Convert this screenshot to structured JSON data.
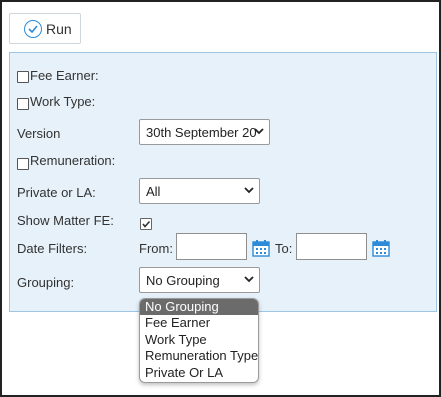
{
  "toolbar": {
    "run_label": "Run"
  },
  "form": {
    "fee_earner_label": "Fee Earner:",
    "work_type_label": "Work Type:",
    "version_label": "Version",
    "version_value": "30th September 20",
    "remuneration_label": "Remuneration:",
    "private_la_label": "Private or LA:",
    "private_la_value": "All",
    "show_matter_fe_label": "Show Matter FE:",
    "show_matter_fe_checked": true,
    "date_filters_label": "Date Filters:",
    "from_label": "From:",
    "to_label": "To:",
    "from_value": "",
    "to_value": "",
    "grouping_label": "Grouping:",
    "grouping_value": "No Grouping"
  },
  "grouping_dropdown": {
    "options": [
      "No Grouping",
      "Fee Earner",
      "Work Type",
      "Remuneration Type",
      "Private Or LA"
    ],
    "selected_index": 0
  },
  "colors": {
    "panel_bg": "#e6f1fa",
    "panel_border": "#9cc6e4",
    "accent_blue": "#2e8bd8",
    "selected_option_bg": "#6b6b6b"
  },
  "icons": {
    "run": "check-circle-icon",
    "calendar": "calendar-icon",
    "dropdown": "chevron-down-icon"
  }
}
